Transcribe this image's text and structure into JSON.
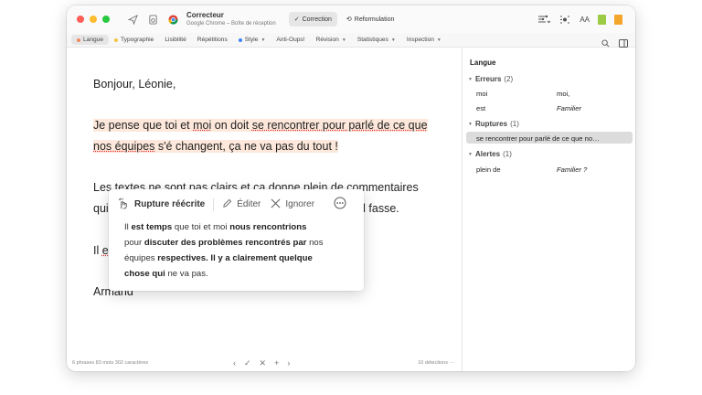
{
  "titlebar": {
    "app_title": "Correcteur",
    "app_subtitle": "Google Chrome – Boîte de réception",
    "tab_correction": "Correction",
    "tab_reformulation": "Reformulation",
    "font_size_label": "AA"
  },
  "categories": [
    {
      "label": "Langue",
      "dot": "#f08a5d",
      "active": true
    },
    {
      "label": "Typographie",
      "dot": "#f4c542"
    },
    {
      "label": "Lisibilité"
    },
    {
      "label": "Répétitions"
    },
    {
      "label": "Style",
      "dot": "#3b82f6",
      "chevron": true
    },
    {
      "label": "Anti-Oups!"
    },
    {
      "label": "Révision",
      "chevron": true
    },
    {
      "label": "Statistiques",
      "chevron": true
    },
    {
      "label": "Inspection",
      "chevron": true
    }
  ],
  "editor": {
    "greeting": "Bonjour, Léonie,",
    "p1_a": "Je pense que toi et ",
    "p1_moi": "moi",
    "p1_b": " on doit ",
    "p1_c": "se rencontrer pour parlé de ce que",
    "p1_d": "nos équipes",
    "p1_e": " s'é changent, ça ne va pas du tout !",
    "p2_line1": "Les textes ne sont pas clairs et ça donne plein de commentaires",
    "p2_line2_start": "qui",
    "p2_line2_end": "'il fasse.",
    "p3_start": "Il ",
    "p3_frag": "e",
    "signature": "Armand"
  },
  "status": {
    "counts": "6 phrases   83 mots   302 caractères",
    "detections": "10 détections   ···"
  },
  "sidebar": {
    "title": "Langue",
    "groups": [
      {
        "name": "Erreurs",
        "count": "(2)"
      },
      {
        "name": "Ruptures",
        "count": "(1)"
      },
      {
        "name": "Alertes",
        "count": "(1)"
      }
    ],
    "erreurs": [
      {
        "word": "moi",
        "value": "moi,"
      },
      {
        "word": "est",
        "value": "Familier"
      }
    ],
    "rupture_item": "se rencontrer pour parlé de ce que no…",
    "alertes": [
      {
        "word": "plein de",
        "value": "Familier ?"
      }
    ]
  },
  "popover": {
    "rewrite_label": "Rupture réécrite",
    "edit_label": "Éditer",
    "ignore_label": "Ignorer",
    "t1": "Il ",
    "t2": "est temps",
    "t3": " que toi et moi ",
    "t4": "nous rencontrions",
    "t5": "pour ",
    "t6": "discuter des problèmes rencontrés par",
    "t7": " nos",
    "t8": "équipes ",
    "t9": "respectives. Il y a clairement quelque",
    "t10": "chose qui",
    "t11": " ne va pas."
  }
}
